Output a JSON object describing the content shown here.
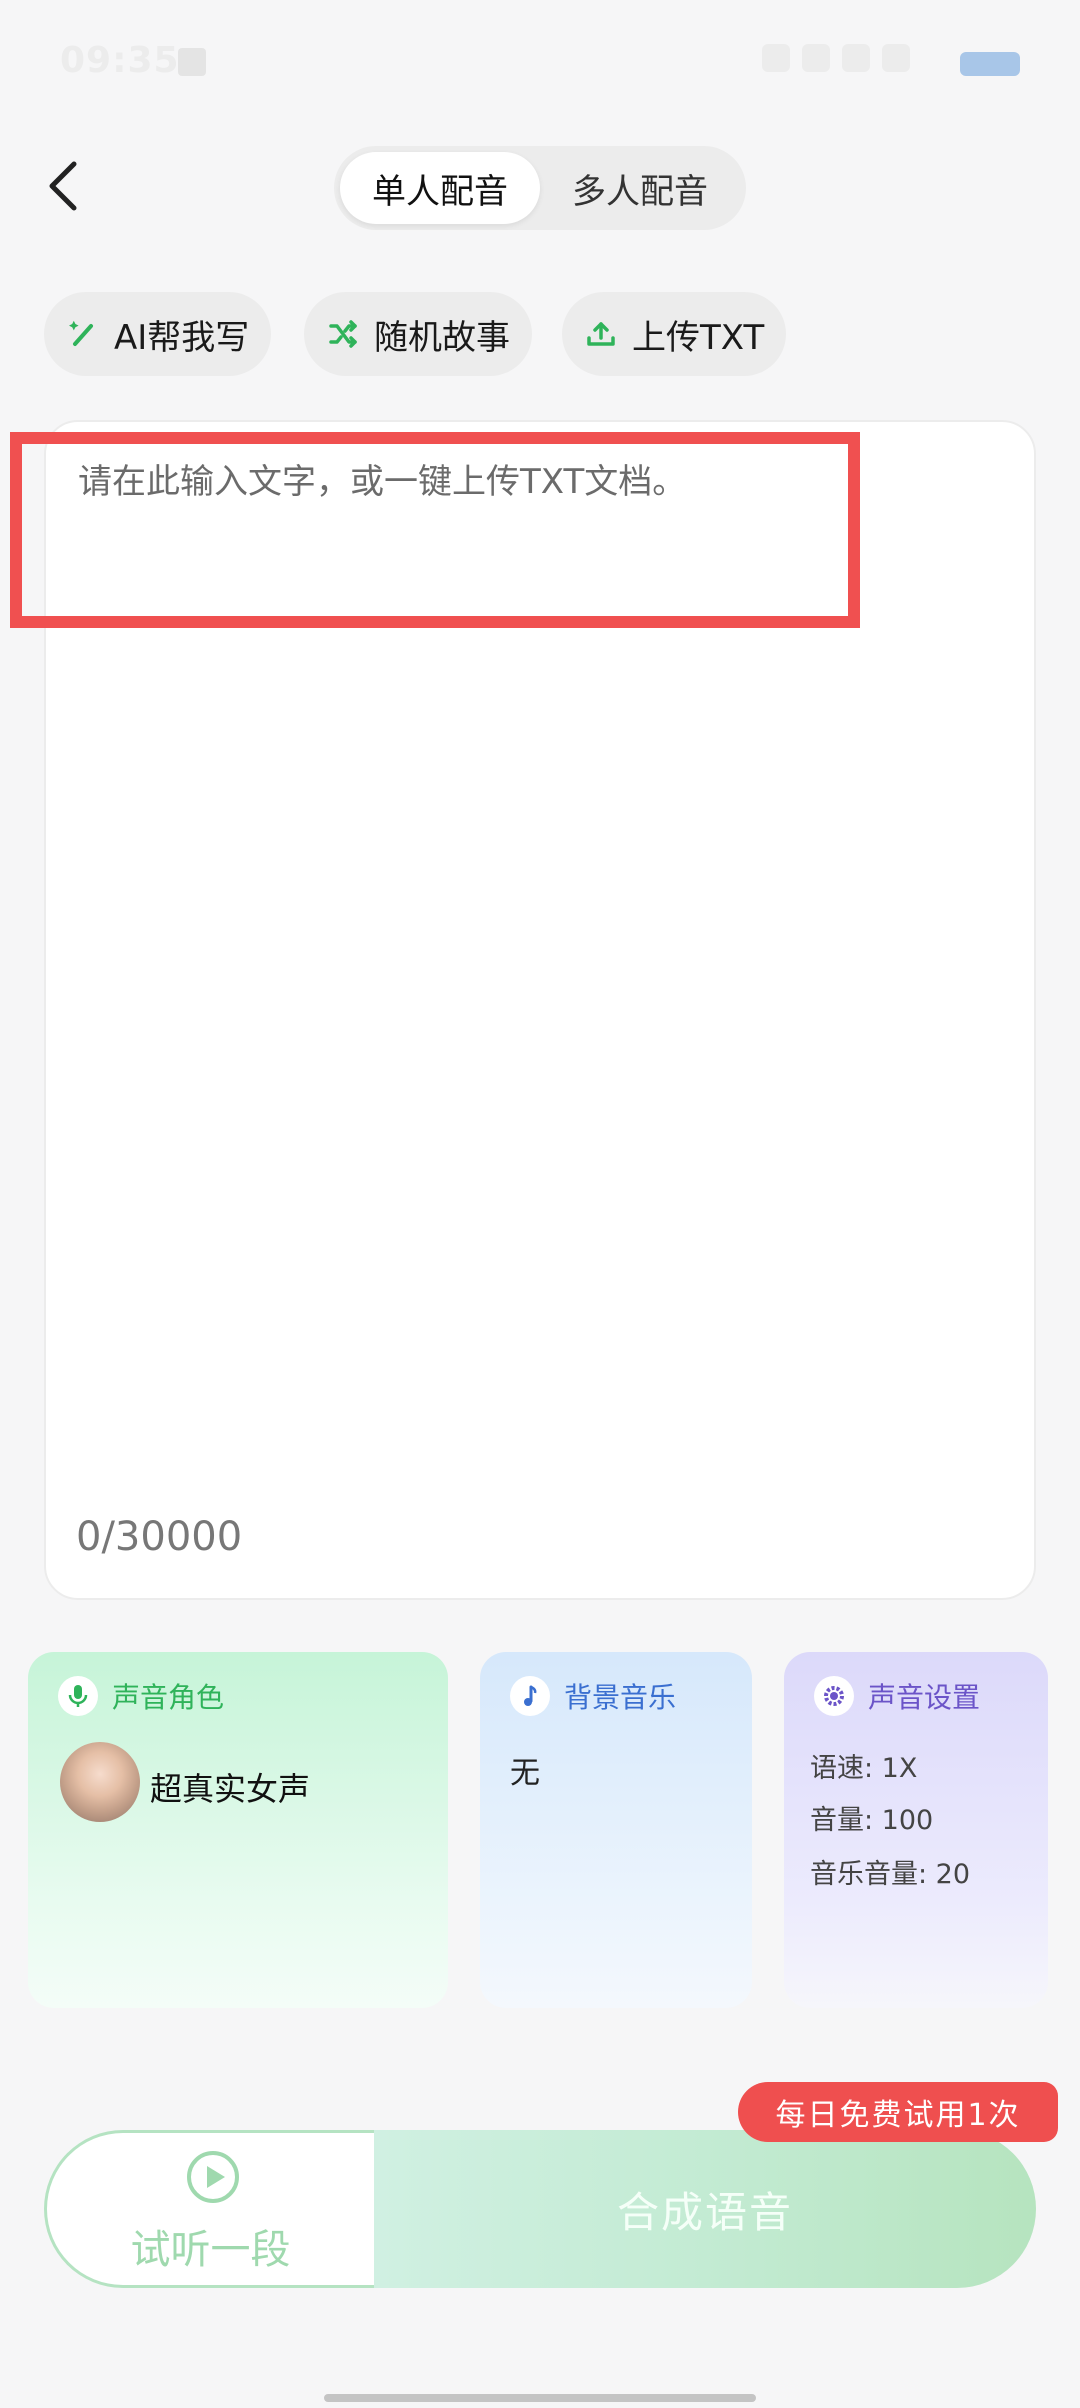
{
  "status_bar": {
    "time": "09:35"
  },
  "header": {
    "tabs": [
      {
        "label": "单人配音",
        "active": true
      },
      {
        "label": "多人配音",
        "active": false
      }
    ]
  },
  "chips": [
    {
      "label": "AI帮我写",
      "icon": "magic-wand-icon"
    },
    {
      "label": "随机故事",
      "icon": "shuffle-icon"
    },
    {
      "label": "上传TXT",
      "icon": "upload-icon"
    }
  ],
  "editor": {
    "placeholder": "请在此输入文字，或一键上传TXT文档。",
    "value": "",
    "counter": "0/30000"
  },
  "cards": {
    "voice": {
      "title": "声音角色",
      "value": "超真实女声",
      "icon": "microphone-icon"
    },
    "bgm": {
      "title": "背景音乐",
      "value": "无",
      "icon": "music-note-icon"
    },
    "settings": {
      "title": "声音设置",
      "icon": "gear-icon",
      "lines": [
        "语速: 1X",
        "音量: 100",
        "音乐音量: 20"
      ]
    }
  },
  "actions": {
    "free_badge": "每日免费试用1次",
    "preview_label": "试听一段",
    "synthesize_label": "合成语音"
  },
  "colors": {
    "accent_green": "#2fb35a",
    "accent_blue": "#3a6fd0",
    "accent_purple": "#6b54c8",
    "badge_red": "#ef4f4f"
  }
}
